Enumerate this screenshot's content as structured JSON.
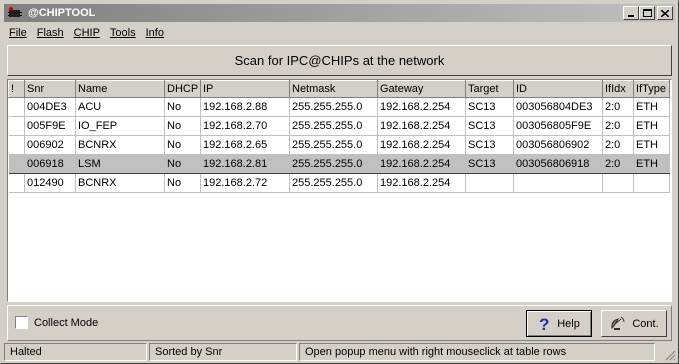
{
  "window": {
    "title": "@CHIPTOOL"
  },
  "menu": [
    {
      "label": "File",
      "key": "F"
    },
    {
      "label": "Flash",
      "key": "F"
    },
    {
      "label": "CHIP",
      "key": "C"
    },
    {
      "label": "Tools",
      "key": "T"
    },
    {
      "label": "Info",
      "key": "I"
    }
  ],
  "scan_label": "Scan for IPC@CHIPs at the network",
  "table": {
    "columns": [
      "!",
      "Snr",
      "Name",
      "DHCP",
      "IP",
      "Netmask",
      "Gateway",
      "Target",
      "ID",
      "IfIdx",
      "IfType"
    ],
    "rows": [
      [
        "",
        "004DE3",
        "ACU",
        "No",
        "192.168.2.88",
        "255.255.255.0",
        "192.168.2.254",
        "SC13",
        "003056804DE3",
        "2:0",
        "ETH"
      ],
      [
        "",
        "005F9E",
        "IO_FEP",
        "No",
        "192.168.2.70",
        "255.255.255.0",
        "192.168.2.254",
        "SC13",
        "003056805F9E",
        "2:0",
        "ETH"
      ],
      [
        "",
        "006902",
        "BCNRX",
        "No",
        "192.168.2.65",
        "255.255.255.0",
        "192.168.2.254",
        "SC13",
        "003056806902",
        "2:0",
        "ETH"
      ],
      [
        "",
        "006918",
        "LSM",
        "No",
        "192.168.2.81",
        "255.255.255.0",
        "192.168.2.254",
        "SC13",
        "003056806918",
        "2:0",
        "ETH"
      ],
      [
        "",
        "012490",
        "BCNRX",
        "No",
        "192.168.2.72",
        "255.255.255.0",
        "192.168.2.254",
        "",
        "",
        "",
        ""
      ]
    ],
    "selected_row": 3
  },
  "collect_mode_label": "Collect Mode",
  "help_label": "Help",
  "cont_label": "Cont.",
  "status": {
    "state": "Halted",
    "sort": "Sorted by Snr",
    "hint": "Open popup menu with right mouseclick at table rows"
  }
}
